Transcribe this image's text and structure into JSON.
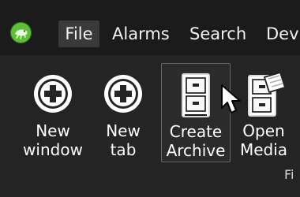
{
  "menubar": {
    "logo": "green-app-logo-icon",
    "items": [
      {
        "label": "File",
        "active": true
      },
      {
        "label": "Alarms"
      },
      {
        "label": "Search"
      },
      {
        "label": "Devi"
      }
    ]
  },
  "ribbon": {
    "buttons": [
      {
        "line1": "New",
        "line2": "window",
        "icon": "plus-circle-icon"
      },
      {
        "line1": "New",
        "line2": "tab",
        "icon": "plus-circle-icon"
      },
      {
        "line1": "Create",
        "line2": "Archive",
        "icon": "file-cabinet-icon"
      },
      {
        "line1": "Open",
        "line2": "Media",
        "icon": "open-file-cabinet-icon"
      }
    ],
    "group_label": "Fi"
  },
  "colors": {
    "menubar_bg": "#1b1b1b",
    "ribbon_bg": "#242424",
    "active_menu_bg": "#3a3a3a",
    "logo_green": "#5cbf34",
    "text": "#ffffff"
  }
}
